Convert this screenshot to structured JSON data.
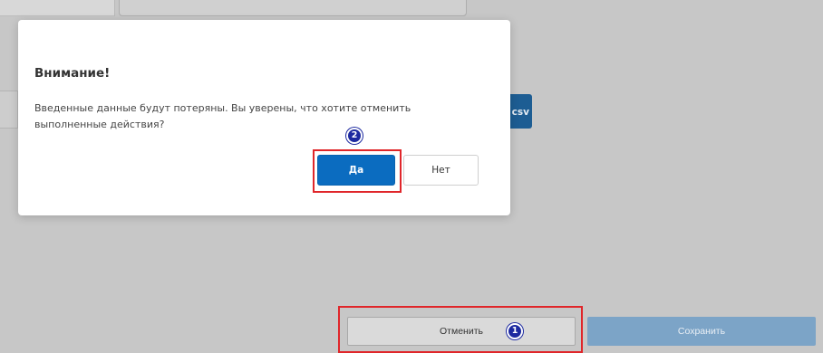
{
  "background_page": {
    "csv_button_label": "csv",
    "cancel_label": "Отменить",
    "save_label": "Сохранить"
  },
  "dialog": {
    "title": "Внимание!",
    "message": "Введенные данные будут потеряны. Вы уверены, что хотите отменить выполненные действия?",
    "yes_label": "Да",
    "no_label": "Нет"
  },
  "annotations": {
    "step_1": "1",
    "step_2": "2"
  },
  "colors": {
    "backdrop": "#c7c7c7",
    "primary_button": "#0b6cc0",
    "save_button_disabled": "#7ca4c7",
    "csv_button": "#1d5d93",
    "highlight_box": "#e0262a",
    "step_badge": "#1d2aa0"
  }
}
